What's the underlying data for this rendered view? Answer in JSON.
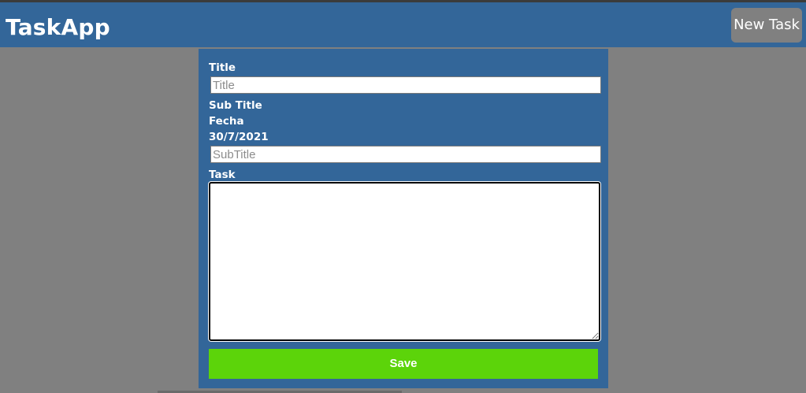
{
  "app": {
    "title": "TaskApp"
  },
  "header": {
    "new_task_label": "New Task"
  },
  "form": {
    "title_label": "Title",
    "title_placeholder": "Title",
    "title_value": "",
    "subtitle_label": "Sub Title",
    "fecha_label": "Fecha",
    "fecha_value": "30/7/2021",
    "subtitle_placeholder": "SubTitle",
    "subtitle_value": "",
    "task_label": "Task",
    "task_value": "",
    "save_label": "Save"
  },
  "colors": {
    "navbar": "#336699",
    "page_background": "#808080",
    "save_button": "#5cd40a",
    "new_task_button": "#808080"
  }
}
